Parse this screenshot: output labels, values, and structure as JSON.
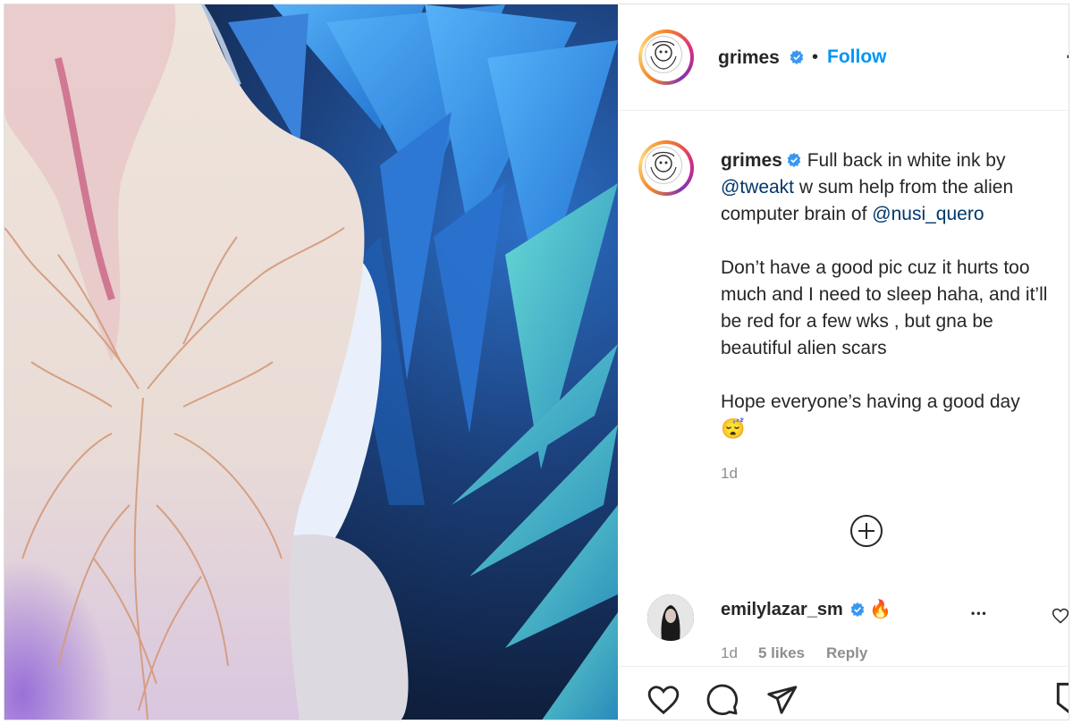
{
  "post": {
    "username": "grimes",
    "follow_label": "Follow",
    "separator": "•",
    "caption_lines": {
      "line1": "Full back in white ink by",
      "mention1": "@tweakt",
      "line2_rest": " w sum help from the alien",
      "line3": "computer brain of ",
      "mention2": "@nusi_quero",
      "para2": "Don’t have a good pic cuz it hurts too much and I need to sleep haha, and it’ll be red for a few wks , but gna be beautiful alien scars",
      "para3": "Hope everyone’s having a good day"
    },
    "emoji": "😴",
    "time": "1d"
  },
  "comment": {
    "username": "emilylazar_sm",
    "text": "🔥",
    "time": "1d",
    "likes": "5 likes",
    "reply_label": "Reply",
    "more": "•••"
  },
  "icons": {
    "header_more": "more-options-icon",
    "verified": "verified-badge-icon",
    "load_more": "plus-circle-icon",
    "like": "heart-icon",
    "comment": "comment-bubble-icon",
    "share": "send-icon",
    "save": "bookmark-icon",
    "comment_like": "small-heart-icon"
  },
  "colors": {
    "accent": "#0095f6",
    "verified": "#3897f0",
    "muted": "#8e8e8e",
    "mention": "#00376b"
  }
}
